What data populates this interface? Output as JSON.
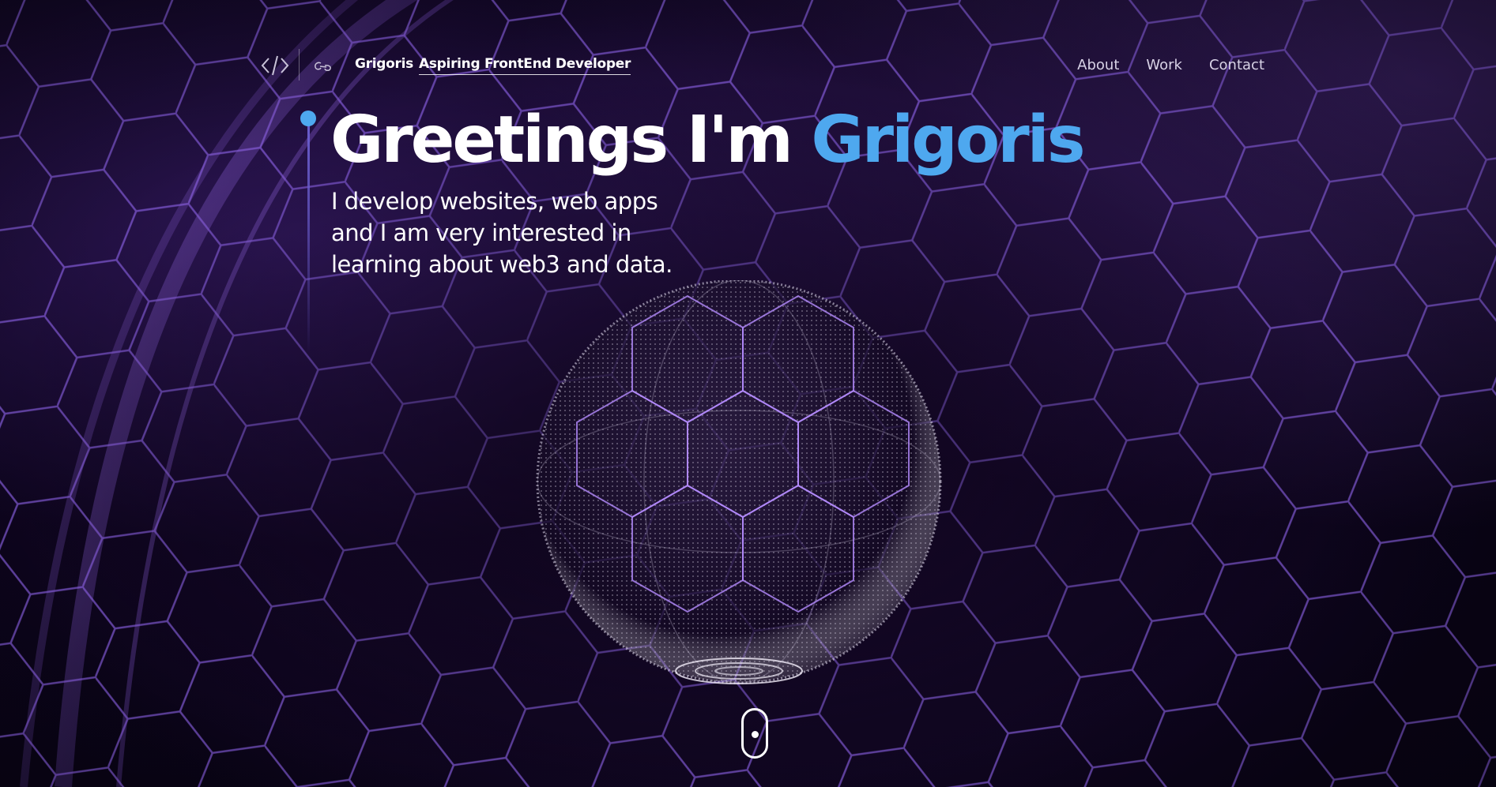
{
  "header": {
    "logo_icon": "code-brackets-icon",
    "link_icon": "link-icon",
    "brand_name": "Grigoris",
    "brand_role": "Aspiring FrontEnd Developer",
    "nav": [
      {
        "label": "About"
      },
      {
        "label": "Work"
      },
      {
        "label": "Contact"
      }
    ]
  },
  "hero": {
    "title_prefix": "Greetings I'm ",
    "title_name": "Grigoris",
    "subtitle_lines": [
      "I develop websites, web apps",
      "and I am very interested in",
      "learning about web3 and data."
    ]
  },
  "scroll": {
    "icon": "mouse-scroll-icon"
  },
  "colors": {
    "accent": "#4ea8ef",
    "background": "#07030f",
    "hex_grid": "#8a5cf0",
    "text": "#ffffff"
  }
}
